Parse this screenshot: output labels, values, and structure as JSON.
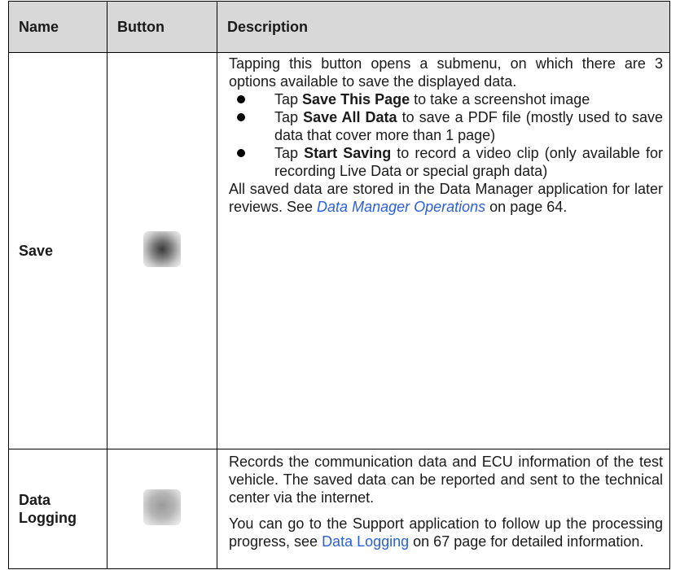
{
  "header": {
    "name": "Name",
    "button": "Button",
    "description": "Description"
  },
  "rows": [
    {
      "name": "Save",
      "icon": "save-icon",
      "intro": "Tapping this button opens a submenu, on which there are 3 options available to save the displayed data.",
      "bullets": [
        {
          "pre": "Tap ",
          "bold": "Save This Page",
          "post": " to take a screenshot image"
        },
        {
          "pre": "Tap ",
          "bold": "Save All Data",
          "post": " to save a PDF file (mostly used to save data that cover more than 1 page)"
        },
        {
          "pre": "Tap ",
          "bold": "Start Saving",
          "post": " to record a video clip (only available for recording Live Data or special graph data)"
        }
      ],
      "outro": {
        "pre": "All saved data are stored in the Data Manager application for later reviews. See ",
        "link": "Data Manager Operations",
        "post": " on page 64."
      }
    },
    {
      "name": "Data Logging",
      "icon": "data-logging-icon",
      "para1": "Records the communication data and ECU information of the test vehicle. The saved data can be reported and sent to the technical center via the internet.",
      "para2": {
        "pre": "You can go to the Support application to follow up the processing progress, see ",
        "link": "Data Logging",
        "post": " on 67 page for detailed information."
      }
    }
  ]
}
